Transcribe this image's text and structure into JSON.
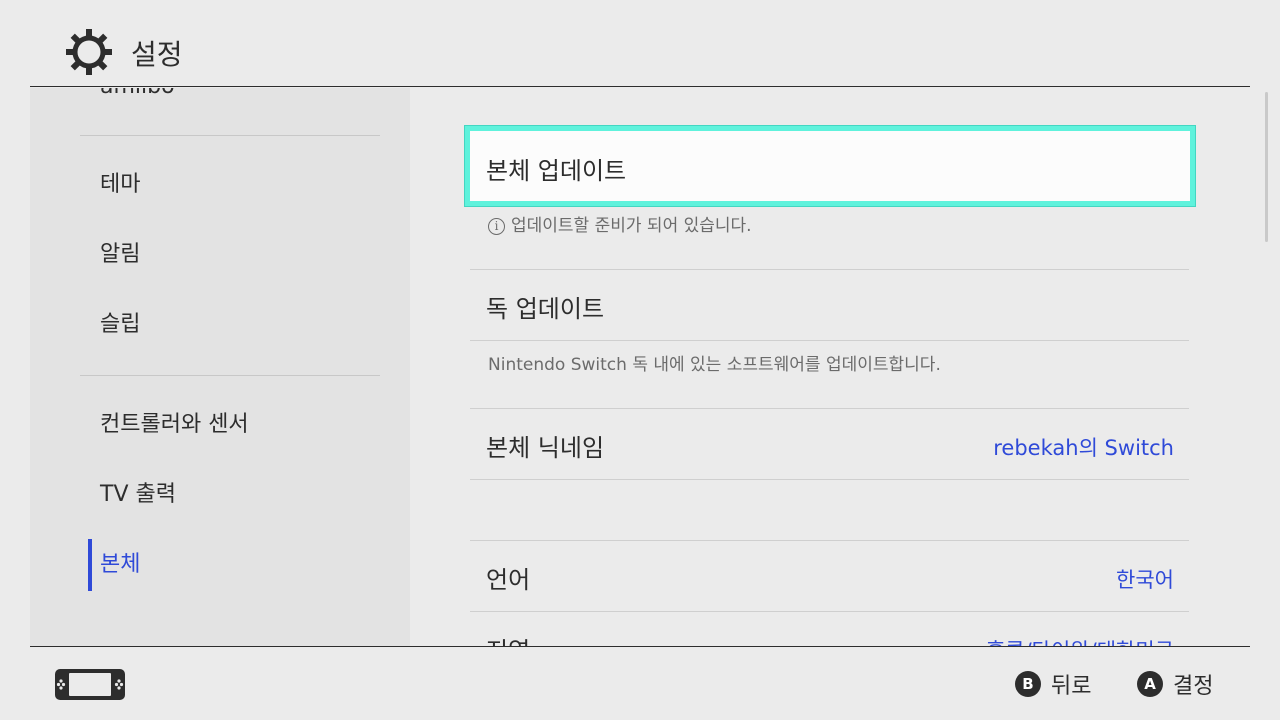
{
  "header": {
    "title": "설정",
    "icon": "gear-icon"
  },
  "sidebar": {
    "items": [
      {
        "label": "amiibo"
      },
      {
        "label": "테마"
      },
      {
        "label": "알림"
      },
      {
        "label": "슬립"
      },
      {
        "label": "컨트롤러와 센서"
      },
      {
        "label": "TV 출력"
      },
      {
        "label": "본체"
      }
    ],
    "active_color": "#2f4ad8"
  },
  "main": {
    "system_update": {
      "label": "본체 업데이트",
      "desc": "업데이트할 준비가 되어 있습니다."
    },
    "dock_update": {
      "label": "독 업데이트",
      "desc": "Nintendo Switch 독 내에 있는 소프트웨어를 업데이트합니다."
    },
    "nickname": {
      "label": "본체 닉네임",
      "value": "rebekah의 Switch"
    },
    "language": {
      "label": "언어",
      "value": "한국어"
    },
    "region": {
      "label": "지역",
      "value": "홍콩/타이완/대한민국"
    }
  },
  "footer": {
    "back": {
      "button": "B",
      "label": "뒤로"
    },
    "ok": {
      "button": "A",
      "label": "결정"
    }
  },
  "colors": {
    "accent": "#2f4ad8",
    "highlight": "#5ff2dc",
    "background": "#ebebeb"
  }
}
